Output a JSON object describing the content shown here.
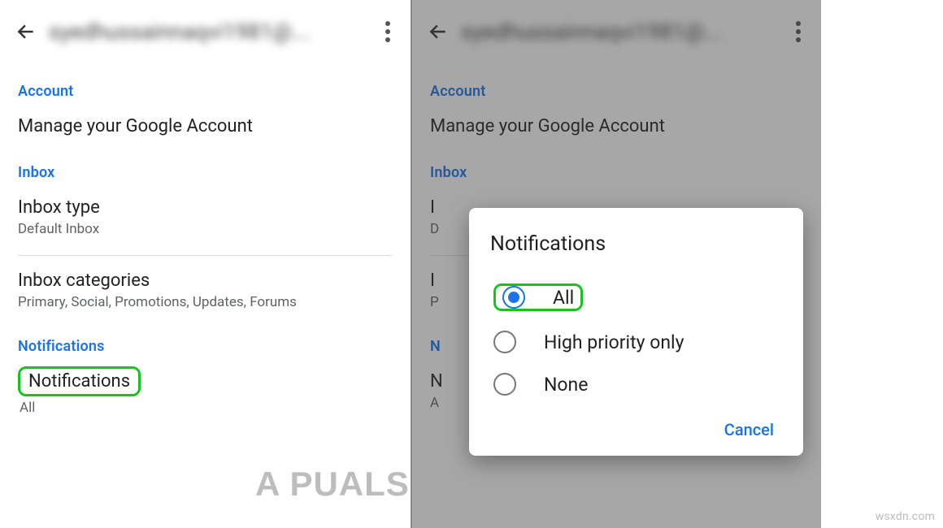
{
  "appbar": {
    "title_blur": "syedhussainnaqvi1981@..."
  },
  "sections": {
    "account_header": "Account",
    "manage_account": "Manage your Google Account",
    "inbox_header": "Inbox",
    "inbox_type_label": "Inbox type",
    "inbox_type_value": "Default Inbox",
    "inbox_categories_label": "Inbox categories",
    "inbox_categories_value": "Primary, Social, Promotions, Updates, Forums",
    "notifications_header": "Notifications",
    "notifications_label": "Notifications",
    "notifications_value": "All"
  },
  "right_truncated": {
    "inbox_type_label_short": "I",
    "inbox_type_value_short": "D",
    "inbox_categories_label_short": "I",
    "inbox_categories_value_short": "P",
    "notifications_header_short": "N",
    "notifications_label_short": "N",
    "notifications_value_short": "A"
  },
  "dialog": {
    "title": "Notifications",
    "options": {
      "all": "All",
      "high": "High priority only",
      "none": "None"
    },
    "cancel": "Cancel"
  },
  "watermark": {
    "brand": "A  PUALS",
    "site": "wsxdn.com"
  }
}
